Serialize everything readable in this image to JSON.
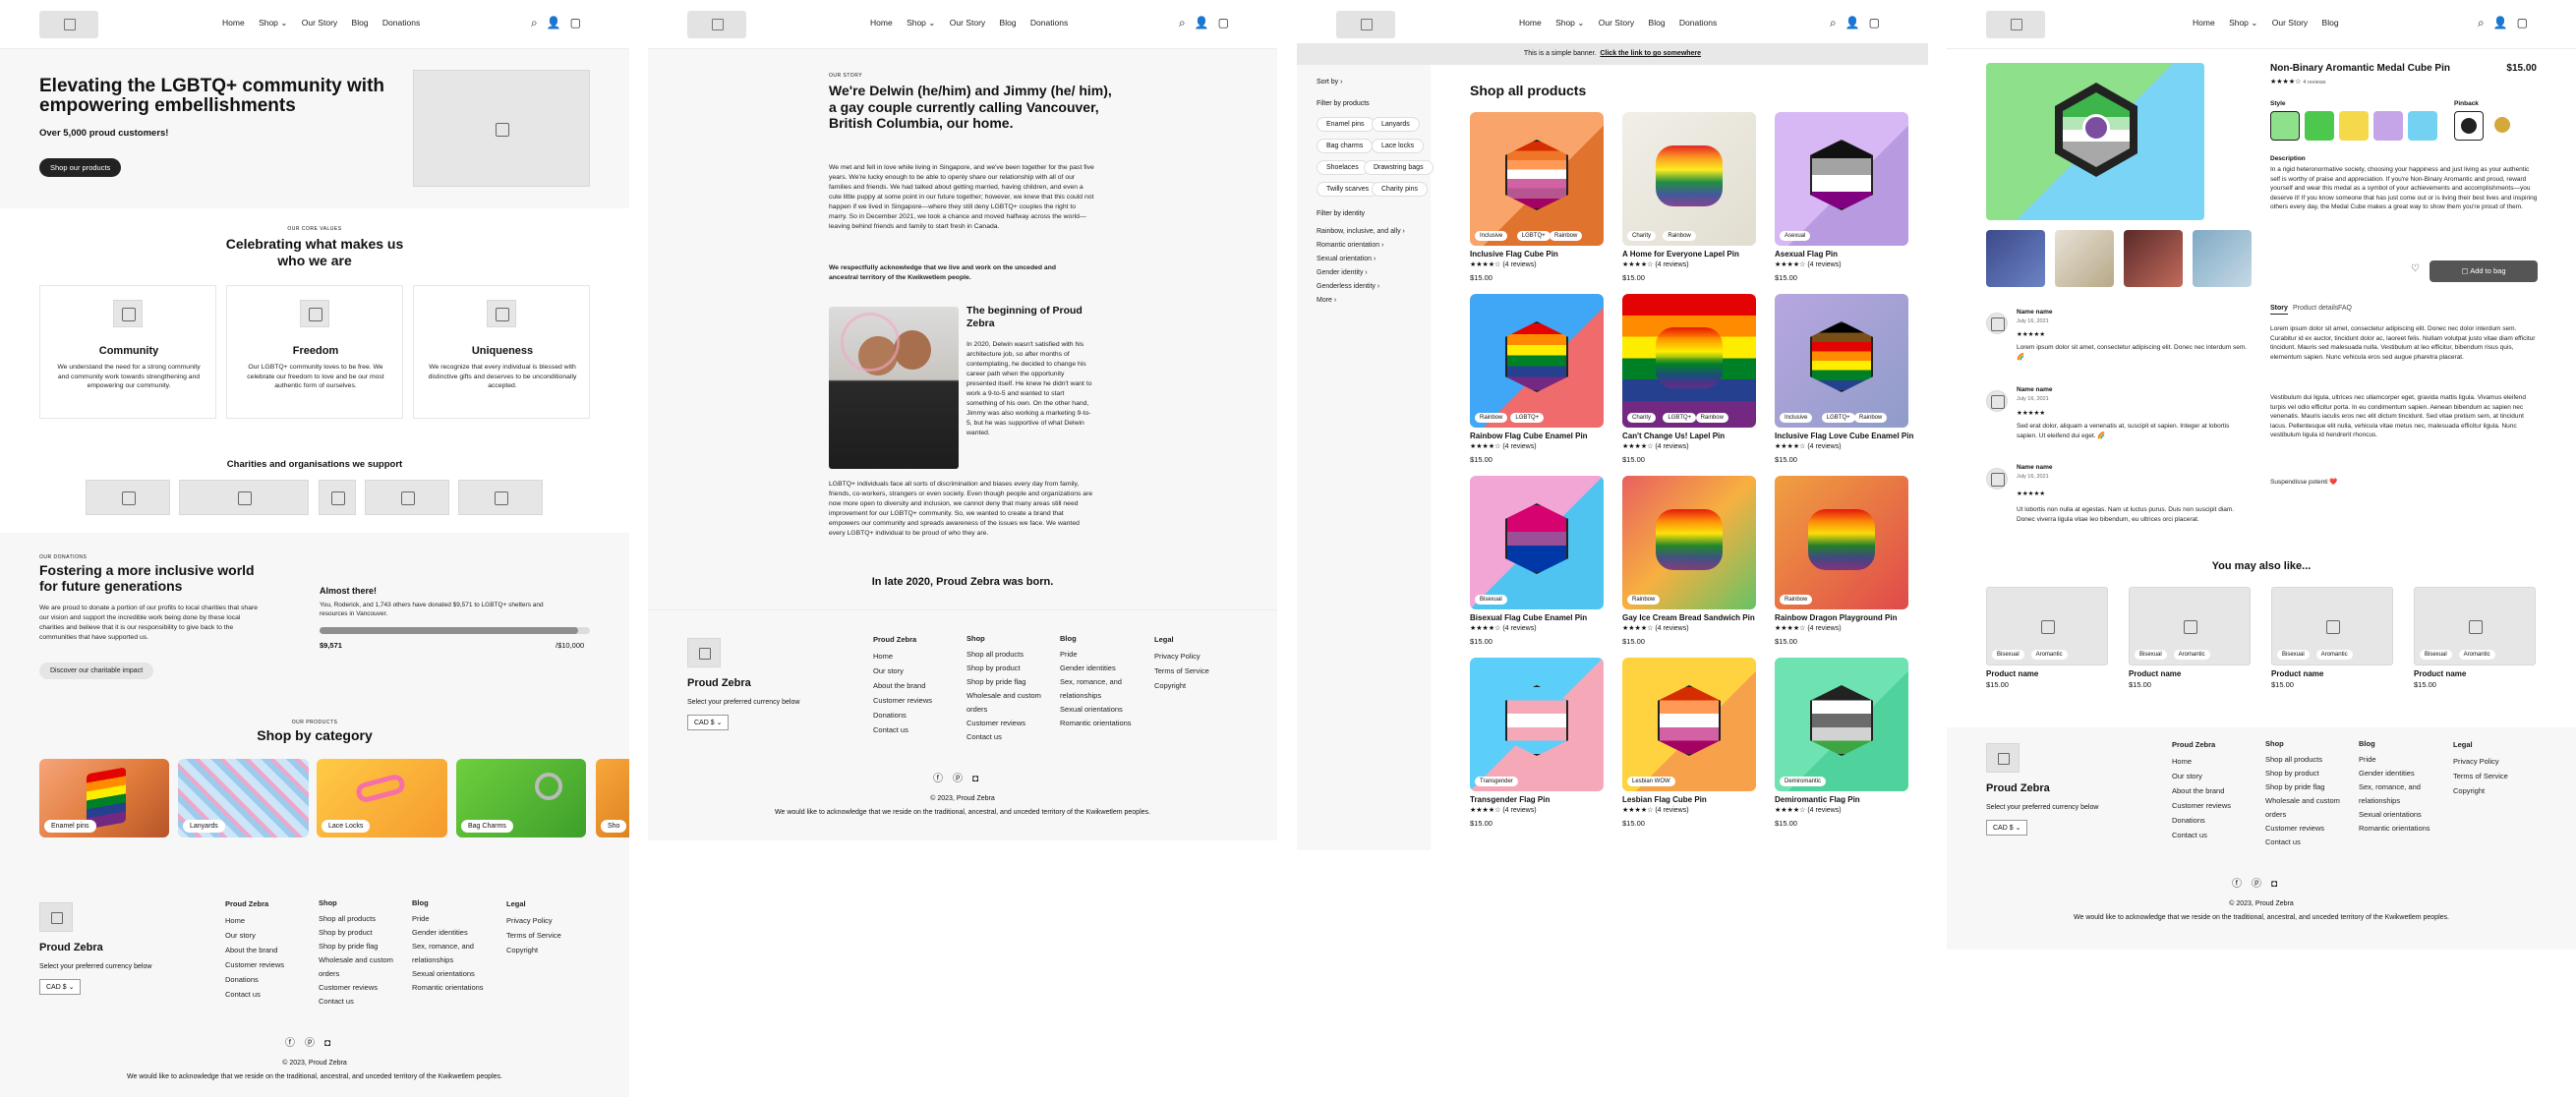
{
  "nav": {
    "home": "Home",
    "shop": "Shop",
    "our_story": "Our Story",
    "blog": "Blog",
    "donations": "Donations"
  },
  "home": {
    "hero_title": "Elevating the LGBTQ+ community with empowering embellishments",
    "hero_sub": "Over 5,000 proud customers!",
    "hero_button": "Shop our products",
    "values_eyebrow": "OUR CORE VALUES",
    "values_title": "Celebrating what makes us who we are",
    "values": [
      {
        "title": "Community",
        "text": "We understand the need for a strong community and community work towards strengthening and empowering our community."
      },
      {
        "title": "Freedom",
        "text": "Our LGBTQ+ community loves to be free. We celebrate our freedom to love and be our most authentic form of ourselves."
      },
      {
        "title": "Uniqueness",
        "text": "We recognize that every individual is blessed with distinctive gifts and deserves to be unconditionally accepted."
      }
    ],
    "charities_title": "Charities and organisations we support",
    "donations_eyebrow": "OUR DONATIONS",
    "donations_title": "Fostering a more inclusive world for future generations",
    "donations_text": "We are proud to donate a portion of our profits to local charities that share our vision and support the incredible work being done by these local charities and believe that it is our responsibility to give back to the communities that have supported us.",
    "donations_button": "Discover our charitable impact",
    "almost": "Almost there!",
    "almost_text": "You, Roderick, and 1,743 others have donated $9,571 to LGBTQ+ shelters and resources in Vancouver.",
    "raised": "$9,571",
    "goal": "/$10,000",
    "progress": 0.957,
    "products_eyebrow": "OUR PRODUCTS",
    "category_title": "Shop by category",
    "categories": [
      "Enamel pins",
      "Lanyards",
      "Lace Locks",
      "Bag Charms",
      "Sho"
    ]
  },
  "story": {
    "eyebrow": "OUR STORY",
    "title": "We're Delwin (he/him) and Jimmy (he/ him), a gay couple currently calling Vancouver, British Columbia, our home.",
    "p1": "We met and fell in love while living in Singapore, and we've been together for the past five years. We're lucky enough to be able to openly share our relationship with all of our families and friends. We had talked about getting married, having children, and even a cute little puppy at some point in our future together; however, we knew that this could not happen if we lived in Singapore—where they still deny LGBTQ+ couples the right to marry. So in December 2021, we took a chance and moved halfway across the world—leaving behind friends and family to start fresh in Canada.",
    "p2": "We respectfully acknowledge that we live and work on the unceded and ancestral territory of the Kwikwetlem people.",
    "sub_title": "The beginning of Proud Zebra",
    "p3": "In 2020, Delwin wasn't satisfied with his architecture job, so after months of contemplating, he decided to change his career path when the opportunity presented itself. He knew he didn't want to work a 9-to-5 and wanted to start something of his own. On the other hand, Jimmy was also working a marketing 9-to-5, but he was supportive of what Delwin wanted.",
    "p4": "LGBTQ+ individuals face all sorts of discrimination and biases every day from family, friends, co-workers, strangers or even society. Even though people and organizations are now more open to diversity and inclusion, we cannot deny that many areas still need improvement for our LGBTQ+ community. So, we wanted to create a brand that empowers our community and spreads awareness of the issues we face. We wanted every LGBTQ+ individual to be proud of who they are.",
    "closing": "In late 2020, Proud Zebra was born."
  },
  "shop": {
    "banner": "This is a simple banner.",
    "banner_link": "Click the link to go somewhere",
    "sort_by": "Sort by",
    "filter_products": "Filter by products",
    "product_chips": [
      "Enamel pins",
      "Lanyards",
      "Bag charms",
      "Lace locks",
      "Shoelaces",
      "Drawstring bags",
      "Twilly scarves",
      "Charity pins"
    ],
    "filter_identity": "Filter by identity",
    "identity_items": [
      "Rainbow, inclusive, and ally",
      "Romantic orientation",
      "Sexual orientation",
      "Gender identity",
      "Genderless identity",
      "More"
    ],
    "title": "Shop all products",
    "products": [
      {
        "name": "Inclusive Flag Cube Pin",
        "reviews": "(4 reviews)",
        "price": "$15.00",
        "badges": [
          "Inclusive",
          "LGBTQ+",
          "Rainbow"
        ]
      },
      {
        "name": "A Home for Everyone Lapel Pin",
        "reviews": "(4 reviews)",
        "price": "$15.00",
        "badges": [
          "Charity",
          "Rainbow"
        ]
      },
      {
        "name": "Asexual Flag Pin",
        "reviews": "(4 reviews)",
        "price": "$15.00",
        "badges": [
          "Asexual"
        ]
      },
      {
        "name": "Rainbow Flag Cube Enamel Pin",
        "reviews": "(4 reviews)",
        "price": "$15.00",
        "badges": [
          "Rainbow",
          "LGBTQ+"
        ]
      },
      {
        "name": "Can't Change Us! Lapel Pin",
        "reviews": "(4 reviews)",
        "price": "$15.00",
        "badges": [
          "Charity",
          "LGBTQ+",
          "Rainbow"
        ]
      },
      {
        "name": "Inclusive Flag Love Cube Enamel Pin",
        "reviews": "(4 reviews)",
        "price": "$15.00",
        "badges": [
          "Inclusive",
          "LGBTQ+",
          "Rainbow"
        ]
      },
      {
        "name": "Bisexual Flag Cube Enamel Pin",
        "reviews": "(4 reviews)",
        "price": "$15.00",
        "badges": [
          "Bisexual"
        ]
      },
      {
        "name": "Gay Ice Cream Bread Sandwich Pin",
        "reviews": "(4 reviews)",
        "price": "$15.00",
        "badges": [
          "Rainbow"
        ]
      },
      {
        "name": "Rainbow Dragon Playground Pin",
        "reviews": "(4 reviews)",
        "price": "$15.00",
        "badges": [
          "Rainbow"
        ]
      },
      {
        "name": "Transgender Flag Pin",
        "reviews": "(4 reviews)",
        "price": "$15.00",
        "badges": [
          "Transgender"
        ]
      },
      {
        "name": "Lesbian Flag Cube Pin",
        "reviews": "(4 reviews)",
        "price": "$15.00",
        "badges": [
          "Lesbian WOW"
        ]
      },
      {
        "name": "Demiromantic Flag Pin",
        "reviews": "(4 reviews)",
        "price": "$15.00",
        "badges": [
          "Demiromantic"
        ]
      }
    ]
  },
  "product": {
    "name": "Non-Binary Aromantic Medal Cube Pin",
    "price": "$15.00",
    "reviews_count": "4 reviews",
    "style_label": "Style",
    "pinback_label": "Pinback",
    "description_label": "Description",
    "description": "In a rigid heteronormative society, choosing your happiness and just living as your authentic self is worthy of praise and appreciation. If you're Non-Binary Aromantic and proud, reward yourself and wear this medal as a symbol of your achievements and accomplishments—you deserve it! If you know someone that has just come out or is living their best lives and inspiring others every day, the Medal Cube makes a great way to show them you're proud of them.",
    "add_to_bag": "Add to bag",
    "tabs": [
      "Story",
      "Product details",
      "FAQ"
    ],
    "story_p1": "Lorem ipsum dolor sit amet, consectetur adipiscing elit. Donec nec dolor interdum sem. Curabitur id ex auctor, tincidunt dolor ac, laoreet felis. Nullam volutpat justo vitae diam efficitur tincidunt. Mauris sed malesuada nulla. Vestibulum at leo efficitur, bibendum risus quis, elementum sapien. Nunc vehicula eros sed augue pharetra placerat.",
    "story_p2": "Vestibulum dui ligula, ultrices nec ullamcorper eget, gravida mattis ligula. Vivamus eleifend turpis vel odio efficitur porta. In eu condimentum sapien. Aenean bibendum ac sapien nec venenatis. Mauris iaculis eros nec elit dictum tincidunt. Sed vitae pretium sem, at tincidunt lacus. Pellentesque elit nulla, vehicula vitae metus nec, malesuada efficitur ligula. Nunc vestibulum ligula id hendrerit rhoncus.",
    "story_p3": "Suspendisse potenti ❤️",
    "reviews": [
      {
        "name": "Name name",
        "date": "July 16, 2021",
        "text": "Lorem ipsum dolor sit amet, consectetur adipiscing elit. Donec nec interdum sem. 🌈"
      },
      {
        "name": "Name name",
        "date": "July 16, 2021",
        "text": "Sed erat dolor, aliquam a venenatis at, suscipit et sapien. Integer at lobortis sapien. Ut eleifend dui eget. 🌈"
      },
      {
        "name": "Name name",
        "date": "July 16, 2021",
        "text": "Ut lobortis non nulla at egestas. Nam ut luctus purus. Duis non suscipit diam. Donec viverra ligula vitae leo bibendum, eu ultrices orci placerat."
      }
    ],
    "may_like": "You may also like...",
    "suggest": [
      {
        "name": "Product name",
        "price": "$15.00",
        "badges": [
          "Bisexual",
          "Aromantic"
        ]
      },
      {
        "name": "Product name",
        "price": "$15.00",
        "badges": [
          "Bisexual",
          "Aromantic"
        ]
      },
      {
        "name": "Product name",
        "price": "$15.00",
        "badges": [
          "Bisexual",
          "Aromantic"
        ]
      },
      {
        "name": "Product name",
        "price": "$15.00",
        "badges": [
          "Bisexual",
          "Aromantic"
        ]
      }
    ]
  },
  "footer": {
    "brand": "Proud Zebra",
    "currency_label": "Select your preferred currency below",
    "currency": "CAD $",
    "col1_title": "Proud Zebra",
    "col1": [
      "Home",
      "Our story",
      "About the brand",
      "Customer reviews",
      "Donations",
      "Contact us"
    ],
    "col2_title": "Shop",
    "col2": [
      "Shop all products",
      "Shop by product",
      "Shop by pride flag",
      "Wholesale and custom orders",
      "Customer reviews",
      "Contact us"
    ],
    "col3_title": "Blog",
    "col3": [
      "Pride",
      "Gender identities",
      "Sex, romance, and relationships",
      "Sexual orientations",
      "Romantic orientations"
    ],
    "col4_title": "Legal",
    "col4": [
      "Privacy Policy",
      "Terms of Service",
      "Copyright"
    ],
    "copyright": "© 2023, Proud Zebra",
    "ack": "We would like to acknowledge that we reside on the traditional, ancestral, and unceded territory of the Kwikwetlem peoples."
  }
}
